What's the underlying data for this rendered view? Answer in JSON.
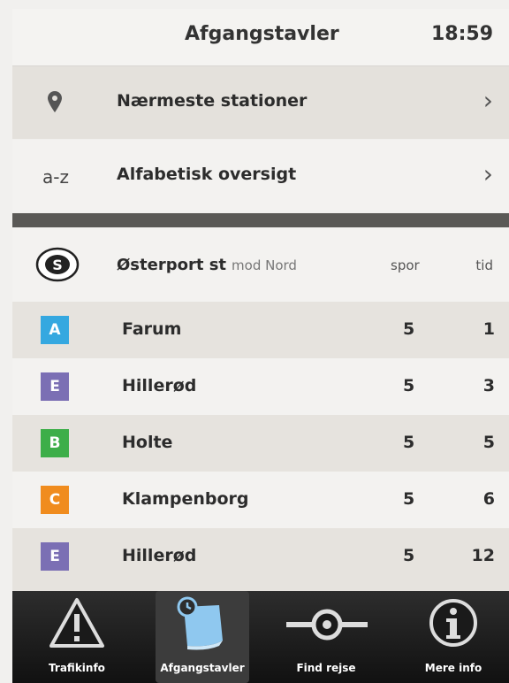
{
  "header": {
    "title": "Afgangstavler",
    "time": "18:59"
  },
  "menu": [
    {
      "icon": "location-pin-icon",
      "label": "Nærmeste stationer"
    },
    {
      "icon_text": "a-z",
      "label": "Alfabetisk oversigt"
    }
  ],
  "station": {
    "name": "Østerport st",
    "direction": "mod Nord",
    "col_spor": "spor",
    "col_tid": "tid"
  },
  "departures": [
    {
      "line": "A",
      "color": "#35a8e0",
      "destination": "Farum",
      "spor": "5",
      "tid": "1"
    },
    {
      "line": "E",
      "color": "#7b6fb4",
      "destination": "Hillerød",
      "spor": "5",
      "tid": "3"
    },
    {
      "line": "B",
      "color": "#3dae49",
      "destination": "Holte",
      "spor": "5",
      "tid": "5"
    },
    {
      "line": "C",
      "color": "#f08c1e",
      "destination": "Klampenborg",
      "spor": "5",
      "tid": "6"
    },
    {
      "line": "E",
      "color": "#7b6fb4",
      "destination": "Hillerød",
      "spor": "5",
      "tid": "12"
    }
  ],
  "tabs": [
    {
      "label": "Trafikinfo",
      "icon": "warning-triangle-icon"
    },
    {
      "label": "Afgangstavler",
      "icon": "departure-board-icon",
      "active": true
    },
    {
      "label": "Find rejse",
      "icon": "route-icon"
    },
    {
      "label": "Mere info",
      "icon": "info-icon"
    }
  ]
}
